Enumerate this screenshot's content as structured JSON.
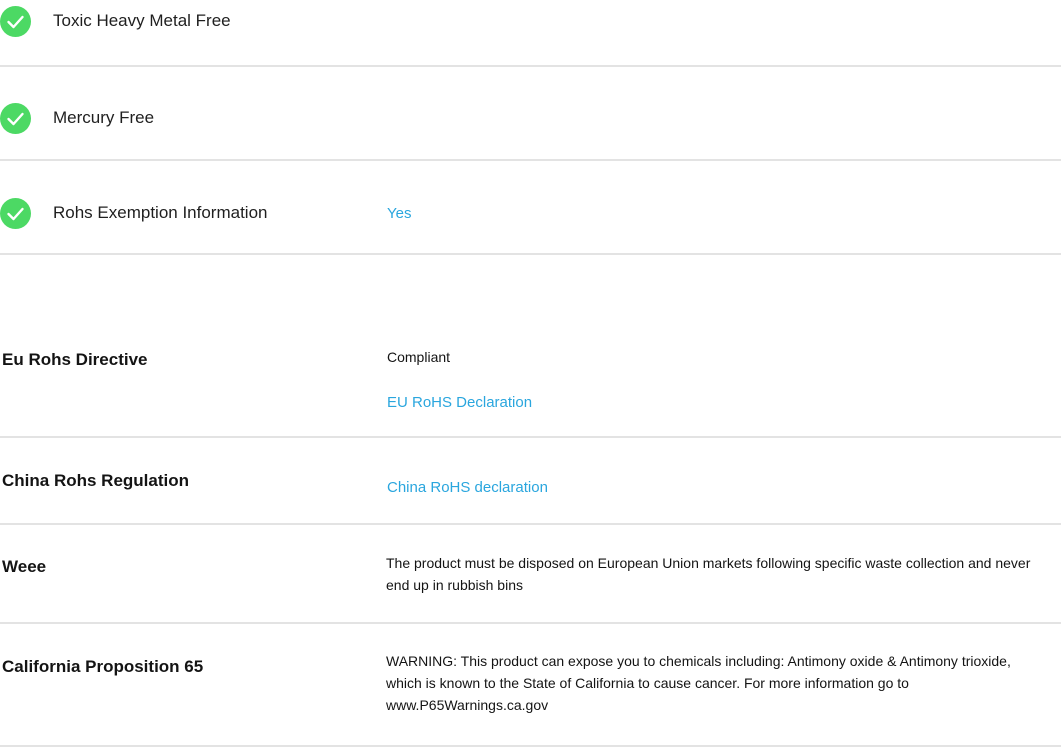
{
  "colors": {
    "check_green": "#4cd964",
    "link_blue": "#2aa6de",
    "divider": "#e3e3e3"
  },
  "compliance_checks": [
    {
      "label": "Toxic Heavy Metal Free",
      "icon": "check-circle-icon"
    },
    {
      "label": "Mercury Free",
      "icon": "check-circle-icon"
    },
    {
      "label": "Rohs Exemption Information",
      "value": "Yes",
      "icon": "check-circle-icon"
    }
  ],
  "regulations": {
    "eu_rohs": {
      "label": "Eu Rohs Directive",
      "status": "Compliant",
      "link": "EU RoHS Declaration"
    },
    "china_rohs": {
      "label": "China Rohs Regulation",
      "link": "China RoHS declaration"
    },
    "weee": {
      "label": "Weee",
      "text": "The product must be disposed on European Union markets following specific waste collection and never end up in rubbish bins"
    },
    "prop65": {
      "label": "California Proposition 65",
      "text": "WARNING: This product can expose you to chemicals including: Antimony oxide & Antimony trioxide, which is known to the State of California to cause cancer. For more information go to www.P65Warnings.ca.gov"
    }
  }
}
